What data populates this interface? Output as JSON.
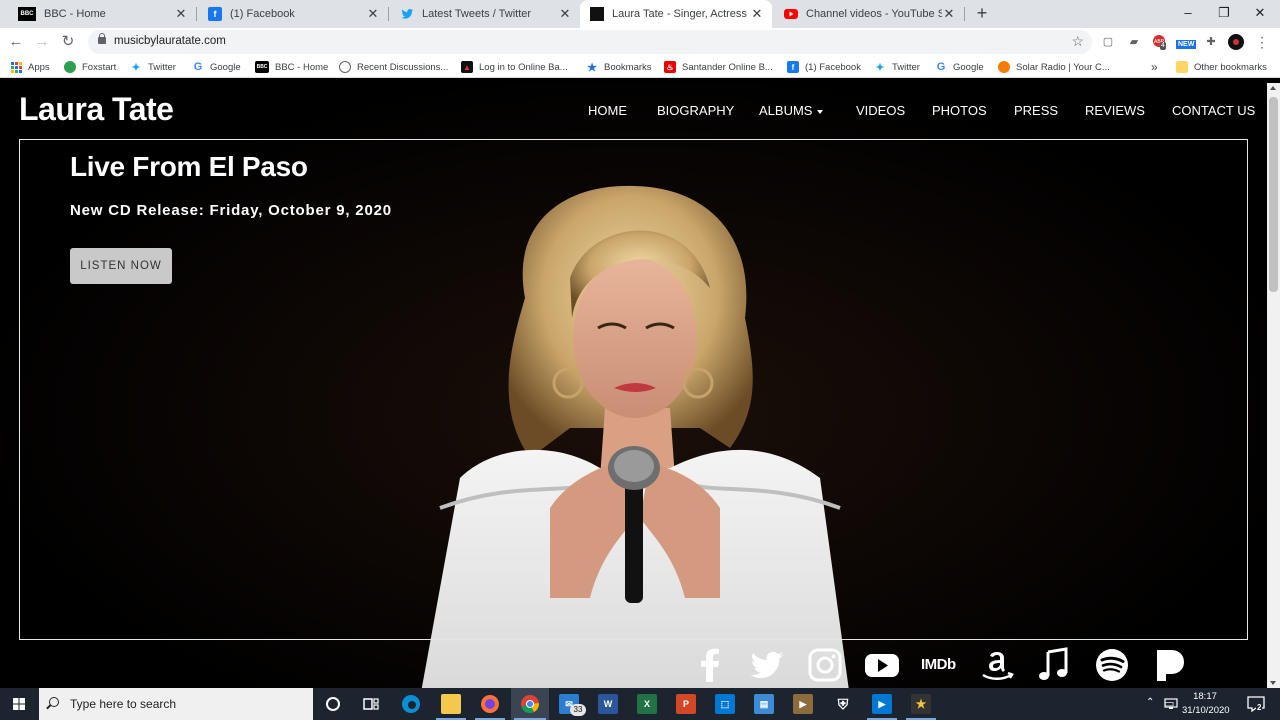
{
  "browser": {
    "tabs": [
      {
        "title": "BBC - Home",
        "favicon": "bbc-icon",
        "active": false
      },
      {
        "title": "(1) Facebook",
        "favicon": "facebook-icon",
        "active": false
      },
      {
        "title": "Latest Tweets / Twitter",
        "favicon": "twitter-icon",
        "active": false
      },
      {
        "title": "Laura Tate - Singer, Actress",
        "favicon": "site-icon",
        "active": true
      },
      {
        "title": "Channel videos - YouTube Studio",
        "favicon": "youtube-icon",
        "active": false
      }
    ],
    "url": "musicbylauratate.com",
    "extension_badges": {
      "abp_count": "4",
      "new_label": "NEW"
    },
    "bookmarks": [
      {
        "label": "Apps",
        "icon": "apps-grid-icon"
      },
      {
        "label": "Foxstart",
        "icon": "foxstart-icon"
      },
      {
        "label": "Twitter",
        "icon": "twitter-icon"
      },
      {
        "label": "Google",
        "icon": "google-icon"
      },
      {
        "label": "BBC - Home",
        "icon": "bbc-icon"
      },
      {
        "label": "Recent Discussions...",
        "icon": "globe-icon"
      },
      {
        "label": "Log in to Online Ba...",
        "icon": "bank-icon"
      },
      {
        "label": "Bookmarks",
        "icon": "star-icon"
      },
      {
        "label": "Santander Online B...",
        "icon": "santander-icon"
      },
      {
        "label": "(1) Facebook",
        "icon": "facebook-icon"
      },
      {
        "label": "Twitter",
        "icon": "twitter-icon"
      },
      {
        "label": "Google",
        "icon": "google-icon"
      },
      {
        "label": "Solar Radio | Your C...",
        "icon": "radio-icon"
      }
    ],
    "overflow_label": "»",
    "other_bookmarks": "Other bookmarks"
  },
  "site": {
    "logo": "Laura Tate",
    "nav": [
      {
        "label": "HOME"
      },
      {
        "label": "BIOGRAPHY"
      },
      {
        "label": "ALBUMS",
        "dropdown": true
      },
      {
        "label": "VIDEOS"
      },
      {
        "label": "PHOTOS"
      },
      {
        "label": "PRESS"
      },
      {
        "label": "REVIEWS"
      },
      {
        "label": "CONTACT US"
      }
    ],
    "hero": {
      "title": "Live From El Paso",
      "subtitle": "New CD Release: Friday, October 9, 2020",
      "cta": "LISTEN NOW"
    },
    "social_icons": [
      "facebook-icon",
      "twitter-icon",
      "instagram-icon",
      "youtube-icon",
      "imdb-icon",
      "amazon-icon",
      "music-note-icon",
      "spotify-icon",
      "pandora-icon"
    ],
    "imdb_label": "IMDb"
  },
  "taskbar": {
    "search_placeholder": "Type here to search",
    "mail_badge": "33",
    "time": "18:17",
    "date": "31/10/2020",
    "notification_count": "2"
  }
}
